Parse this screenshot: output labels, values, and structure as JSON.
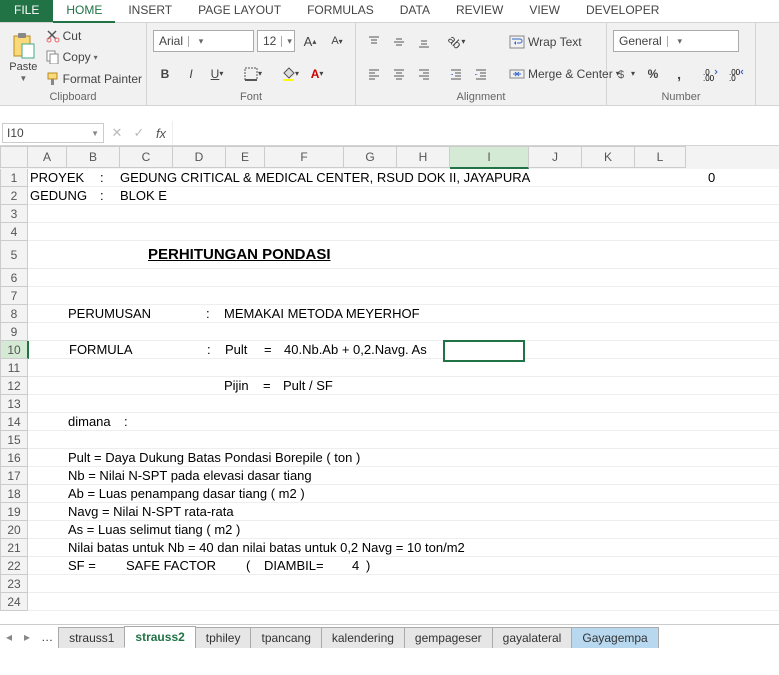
{
  "tabs": {
    "file": "FILE",
    "home": "HOME",
    "insert": "INSERT",
    "pagelayout": "PAGE LAYOUT",
    "formulas": "FORMULAS",
    "data": "DATA",
    "review": "REVIEW",
    "view": "VIEW",
    "developer": "DEVELOPER"
  },
  "ribbon": {
    "paste": "Paste",
    "cut": "Cut",
    "copy": "Copy",
    "format_painter": "Format Painter",
    "clipboard_label": "Clipboard",
    "font_name": "Arial",
    "font_size": "12",
    "font_label": "Font",
    "wrap": "Wrap Text",
    "merge": "Merge & Center",
    "align_label": "Alignment",
    "numfmt": "General",
    "num_label": "Number"
  },
  "namebox": "I10",
  "cols": [
    "A",
    "B",
    "C",
    "D",
    "E",
    "F",
    "G",
    "H",
    "I",
    "J",
    "K",
    "L"
  ],
  "widths": [
    26,
    38,
    52,
    52,
    52,
    38,
    78,
    52,
    52,
    78,
    52,
    52,
    50
  ],
  "cells": {
    "r1a": "PROYEK",
    "r1b": ":",
    "r1c": "GEDUNG CRITICAL & MEDICAL CENTER, RSUD DOK II, JAYAPURA",
    "r1l": "0",
    "r2a": "GEDUNG",
    "r2b": ":",
    "r2c": "BLOK E",
    "r5": "PERHITUNGAN PONDASI ",
    "r8b": "PERUMUSAN",
    "r8e": ":",
    "r8f": "MEMAKAI METODA MEYERHOF",
    "r10b": "FORMULA",
    "r10e": ":",
    "r10f": "Pult",
    "r10f2": "=",
    "r10f3": "40.Nb.Ab + 0,2.Navg. As",
    "r12f": "Pijin",
    "r12f2": "=",
    "r12f3": "Pult / SF",
    "r14b": "dimana",
    "r14c": ":",
    "r16": "Pult    = Daya Dukung Batas Pondasi Borepile ( ton )",
    "r17": "Nb     = Nilai N-SPT pada elevasi dasar tiang",
    "r18": "Ab     = Luas penampang dasar tiang  ( m2 )",
    "r19": "Navg  = Nilai N-SPT rata-rata",
    "r20": "As     = Luas selimut tiang   ( m2 )",
    "r21": "Nilai batas untuk Nb = 40 dan nilai batas untuk 0,2 Navg = 10 ton/m2",
    "r22a": "SF     =",
    "r22b": "SAFE FACTOR",
    "r22c": "(",
    "r22d": "DIAMBIL=",
    "r22e": "4",
    "r22f": ")"
  },
  "sheets": {
    "s1": "strauss1",
    "s2": "strauss2",
    "s3": "tphiley",
    "s4": "tpancang",
    "s5": "kalendering",
    "s6": "gempageser",
    "s7": "gayalateral",
    "s8": "Gayagempa"
  }
}
